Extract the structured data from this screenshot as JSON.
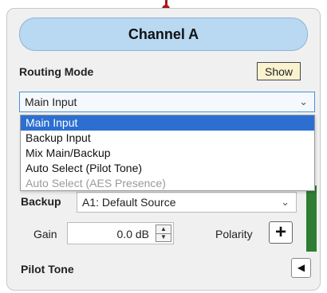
{
  "header": {
    "title": "Channel A"
  },
  "routing": {
    "label": "Routing Mode",
    "show_button": "Show",
    "selected": "Main Input",
    "options": [
      "Main Input",
      "Backup Input",
      "Mix Main/Backup",
      "Auto Select (Pilot Tone)",
      "Auto Select (AES Presence)"
    ]
  },
  "backup": {
    "label": "Backup",
    "selected": "A1: Default Source"
  },
  "gain": {
    "label": "Gain",
    "value": "0.0 dB"
  },
  "polarity": {
    "label": "Polarity",
    "symbol": "+"
  },
  "pilot": {
    "label": "Pilot Tone"
  },
  "icons": {
    "dropdown": "chevron-down-icon",
    "collapse": "triangle-left-icon",
    "spinner": "spin-up-down-icon"
  },
  "colors": {
    "header_bg": "#b9d8f2",
    "selection": "#2c6fd1",
    "meter_green": "#2e7d32",
    "connector": "#a5191c",
    "show_button_bg": "#fbf3cf"
  }
}
